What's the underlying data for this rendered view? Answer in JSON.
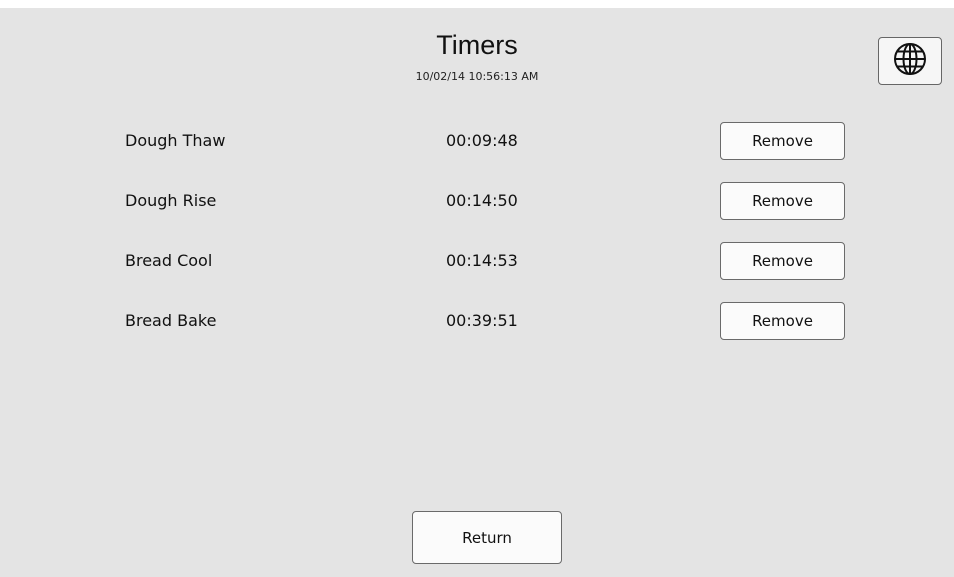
{
  "header": {
    "title": "Timers",
    "datetime": "10/02/14  10:56:13 AM",
    "language_icon": "globe-icon"
  },
  "timers": [
    {
      "name": "Dough Thaw",
      "time": "00:09:48",
      "action_label": "Remove"
    },
    {
      "name": "Dough Rise",
      "time": "00:14:50",
      "action_label": "Remove"
    },
    {
      "name": "Bread Cool",
      "time": "00:14:53",
      "action_label": "Remove"
    },
    {
      "name": "Bread Bake",
      "time": "00:39:51",
      "action_label": "Remove"
    }
  ],
  "footer": {
    "return_label": "Return"
  },
  "colors": {
    "background": "#e4e4e4",
    "button_fill": "#fbfbfb",
    "button_border": "#6a6a6a"
  }
}
